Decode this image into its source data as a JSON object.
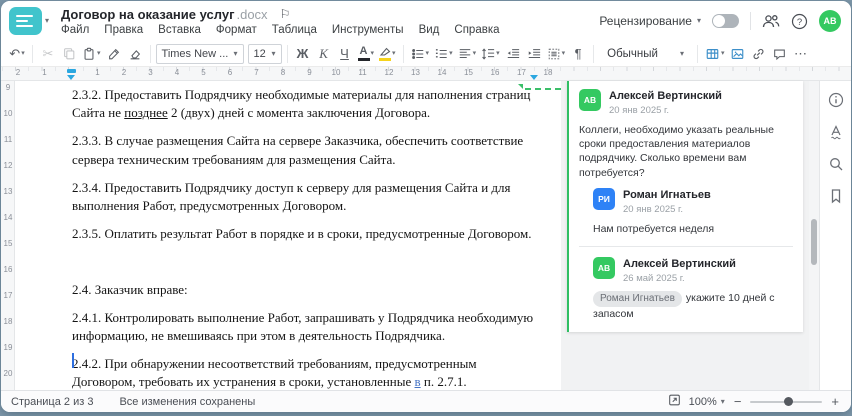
{
  "colors": {
    "teal": "#41c4cc",
    "accent": "#2ba7e0",
    "icon_blue": "#3d8fc9",
    "green": "#2fbf63",
    "avatar_green": "#34c961",
    "avatar_blue": "#2e82f6",
    "steel_bg": "#7e98aa",
    "ins_blue": "#4472c4"
  },
  "header": {
    "title": "Договор на оказание услуг",
    "ext": ".docx",
    "menu": [
      "Файл",
      "Правка",
      "Вставка",
      "Формат",
      "Таблица",
      "Инструменты",
      "Вид",
      "Справка"
    ],
    "review_label": "Рецензирование",
    "avatar_initials": "АВ"
  },
  "toolbar": {
    "font_name": "Times New ...",
    "font_size": "12",
    "bold": "Ж",
    "italic": "К",
    "underline": "Ч",
    "font_color_letter": "А",
    "style_name": "Обычный"
  },
  "icons": {
    "caret": "▾",
    "undo": "↶",
    "cut": "✂",
    "paragraph_mark": "¶",
    "more": "⋯",
    "flag": "⚐",
    "minus": "−",
    "plus": "+"
  },
  "ruler": {
    "h_margin_numbers": [
      "2",
      "1"
    ],
    "h_numbers": [
      "1",
      "2",
      "3",
      "4",
      "5",
      "6",
      "7",
      "8",
      "9",
      "10",
      "11",
      "12",
      "13",
      "14",
      "15",
      "16",
      "17",
      "18"
    ],
    "v_numbers": [
      "9",
      "10",
      "11",
      "12",
      "13",
      "14",
      "15",
      "16",
      "17",
      "18",
      "19",
      "20"
    ]
  },
  "document": {
    "p232_a": "2.3.2. Предоставить Подрядчику необходимые материалы для наполнения страниц Сайта не ",
    "p232_ins": "позднее",
    "p232_b": " 2 (двух) дней с момента заключения Договора.",
    "p233": "2.3.3. В случае размещения Сайта на сервере Заказчика, обеспечить соответствие сервера техническим требованиям для размещения Сайта.",
    "p234": "2.3.4. Предоставить Подрядчику доступ к серверу для размещения Сайта и для выполнения Работ, предусмотренных Договором.",
    "p235": "2.3.5. Оплатить результат Работ в порядке и в сроки, предусмотренные Договором.",
    "p24": "2.4. Заказчик вправе:",
    "p241": "2.4.1. Контролировать выполнение Работ, запрашивать у Подрядчика необходимую информацию, не вмешиваясь при этом в деятельность Подрядчика.",
    "p242_a": "2.4.2. При обнаружении несоответствий требованиям, предусмотренным Договором, требовать их устранения в сроки, установленные ",
    "p242_ins": "в",
    "p242_b": " п. 2.7.1."
  },
  "comments": {
    "thread": [
      {
        "initials": "АВ",
        "author": "Алексей Вертинский",
        "date": "20 янв 2025 г.",
        "text": "Коллеги, необходимо указать реальные сроки предоставления материалов подрядчику. Сколько времени вам потребуется?"
      },
      {
        "initials": "РИ",
        "author": "Роман Игнатьев",
        "date": "20 янв 2025 г.",
        "text": "Нам потребуется неделя"
      },
      {
        "initials": "АВ",
        "author": "Алексей Вертинский",
        "date": "26 май 2025 г.",
        "mention": "Роман Игнатьев",
        "text": "укажите 10 дней с запасом"
      }
    ]
  },
  "status": {
    "page_label": "Страница 2 из 3",
    "saved_label": "Все изменения сохранены",
    "zoom_value": "100%"
  }
}
